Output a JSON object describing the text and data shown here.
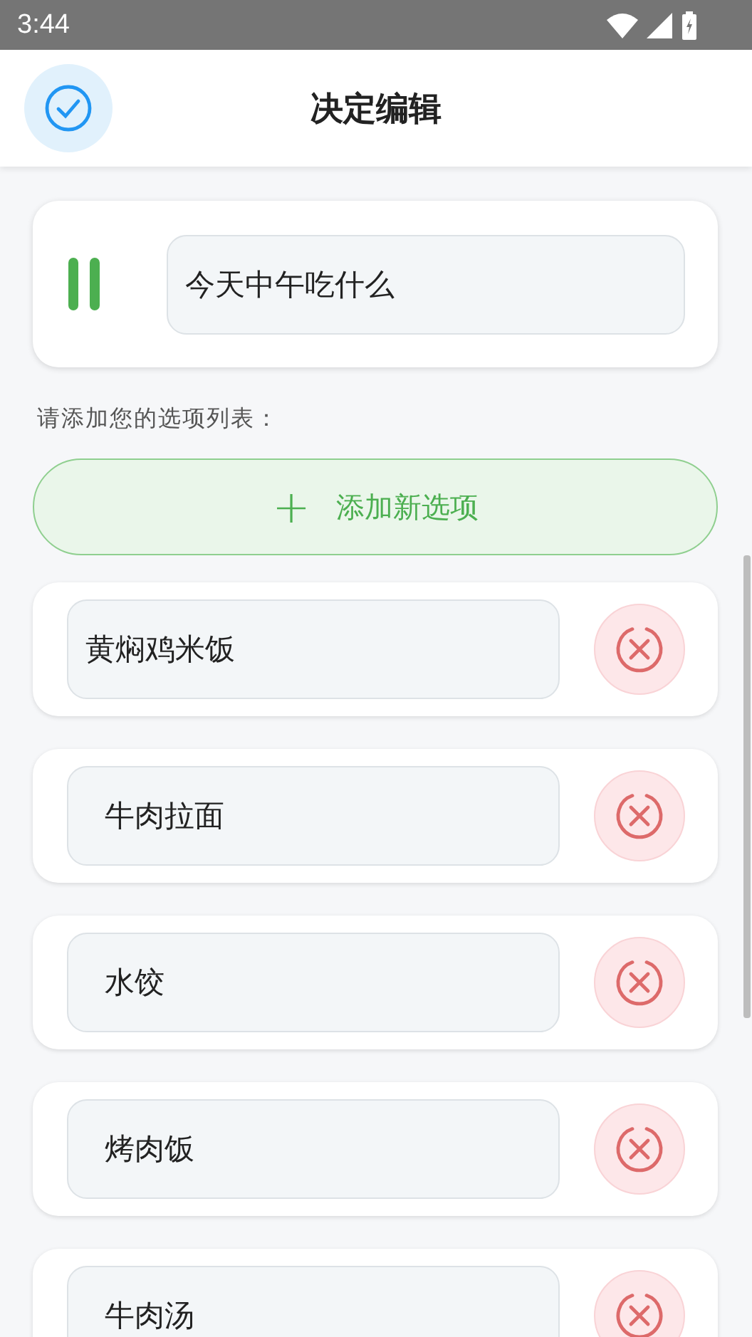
{
  "status_bar": {
    "time": "3:44"
  },
  "header": {
    "title": "决定编辑"
  },
  "topic": {
    "value": "今天中午吃什么"
  },
  "prompt": "请添加您的选项列表：",
  "add_button": {
    "icon": "+",
    "label": "添加新选项"
  },
  "options": [
    {
      "value": "黄焖鸡米饭"
    },
    {
      "value": "  牛肉拉面"
    },
    {
      "value": "  水饺"
    },
    {
      "value": "  烤肉饭"
    },
    {
      "value": "  牛肉汤"
    }
  ]
}
